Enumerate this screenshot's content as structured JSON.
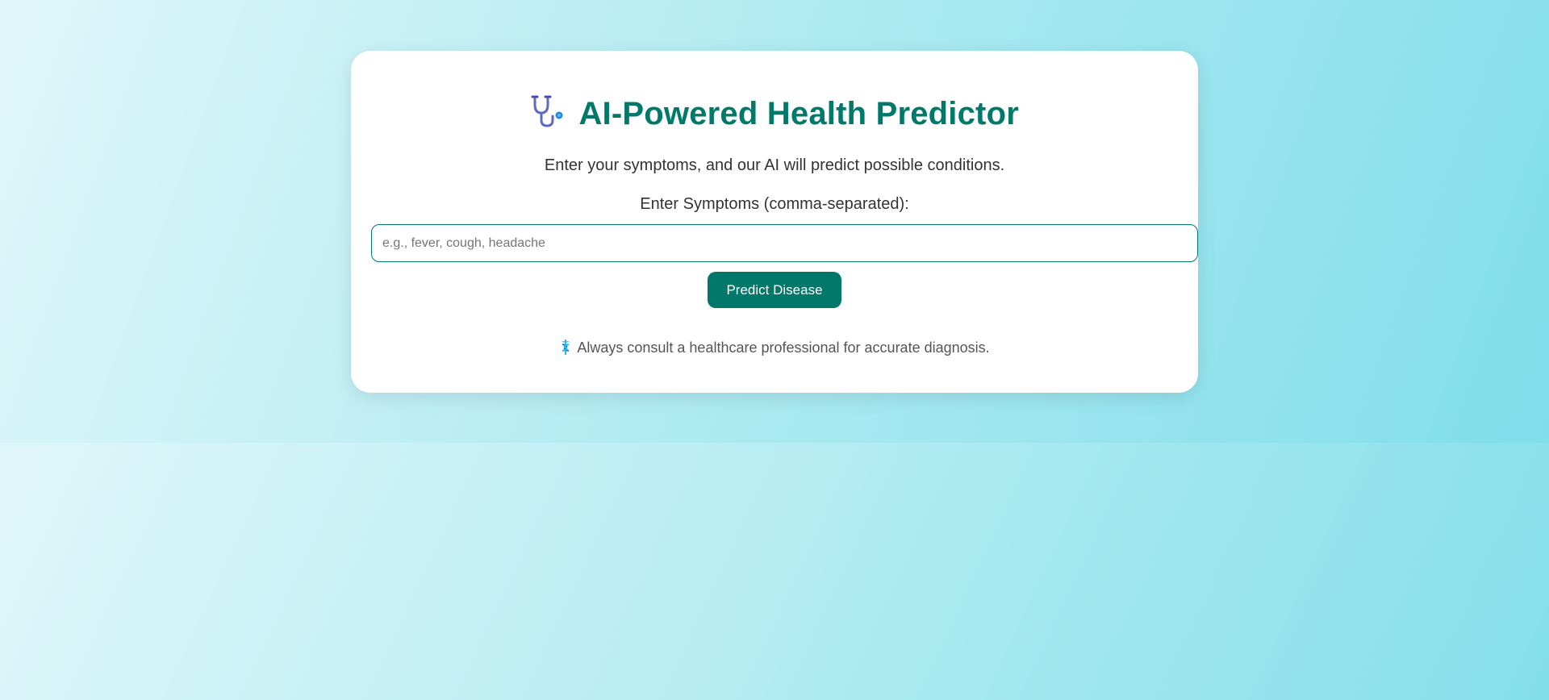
{
  "header": {
    "title": "AI-Powered Health Predictor",
    "title_icon": "stethoscope-icon",
    "subtitle": "Enter your symptoms, and our AI will predict possible conditions."
  },
  "form": {
    "symptoms_label": "Enter Symptoms (comma-separated):",
    "symptoms_value": "",
    "symptoms_placeholder": "e.g., fever, cough, headache",
    "predict_button_label": "Predict Disease"
  },
  "footer": {
    "icon": "caduceus-icon",
    "note": "Always consult a healthcare professional for accurate diagnosis."
  },
  "colors": {
    "accent": "#00796b",
    "background_start": "#e0f7fa",
    "background_end": "#80deea",
    "card": "#ffffff"
  }
}
